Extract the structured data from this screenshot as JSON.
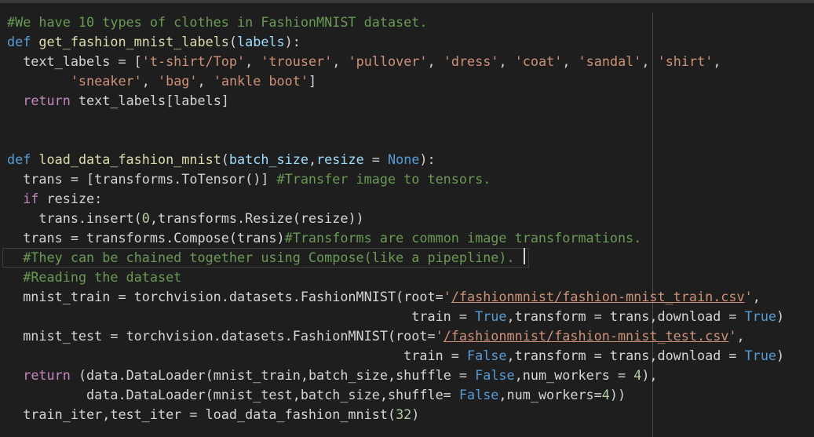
{
  "editor": {
    "lines": [
      [
        {
          "c": "cmt",
          "t": "#We have 10 types of clothes in FashionMNIST dataset."
        }
      ],
      [
        {
          "c": "kw",
          "t": "def "
        },
        {
          "c": "fn",
          "t": "get_fashion_mnist_labels"
        },
        {
          "c": "txt",
          "t": "("
        },
        {
          "c": "var",
          "t": "labels"
        },
        {
          "c": "txt",
          "t": "):"
        }
      ],
      [
        {
          "c": "txt",
          "t": "  text_labels = ["
        },
        {
          "c": "str",
          "t": "'t-shirt/Top'"
        },
        {
          "c": "txt",
          "t": ", "
        },
        {
          "c": "str",
          "t": "'trouser'"
        },
        {
          "c": "txt",
          "t": ", "
        },
        {
          "c": "str",
          "t": "'pullover'"
        },
        {
          "c": "txt",
          "t": ", "
        },
        {
          "c": "str",
          "t": "'dress'"
        },
        {
          "c": "txt",
          "t": ", "
        },
        {
          "c": "str",
          "t": "'coat'"
        },
        {
          "c": "txt",
          "t": ", "
        },
        {
          "c": "str",
          "t": "'sandal'"
        },
        {
          "c": "txt",
          "t": ", "
        },
        {
          "c": "str",
          "t": "'shirt'"
        },
        {
          "c": "txt",
          "t": ","
        }
      ],
      [
        {
          "c": "txt",
          "t": "        "
        },
        {
          "c": "str",
          "t": "'sneaker'"
        },
        {
          "c": "txt",
          "t": ", "
        },
        {
          "c": "str",
          "t": "'bag'"
        },
        {
          "c": "txt",
          "t": ", "
        },
        {
          "c": "str",
          "t": "'ankle boot'"
        },
        {
          "c": "txt",
          "t": "]"
        }
      ],
      [
        {
          "c": "txt",
          "t": "  "
        },
        {
          "c": "kw2",
          "t": "return"
        },
        {
          "c": "txt",
          "t": " text_labels[labels]"
        }
      ],
      [],
      [],
      [
        {
          "c": "kw",
          "t": "def "
        },
        {
          "c": "fn",
          "t": "load_data_fashion_mnist"
        },
        {
          "c": "txt",
          "t": "("
        },
        {
          "c": "var",
          "t": "batch_size"
        },
        {
          "c": "txt",
          "t": ","
        },
        {
          "c": "var",
          "t": "resize"
        },
        {
          "c": "txt",
          "t": " = "
        },
        {
          "c": "kw",
          "t": "None"
        },
        {
          "c": "txt",
          "t": "):"
        }
      ],
      [
        {
          "c": "txt",
          "t": "  trans = [transforms.ToTensor()] "
        },
        {
          "c": "cmt",
          "t": "#Transfer image to tensors."
        }
      ],
      [
        {
          "c": "txt",
          "t": "  "
        },
        {
          "c": "kw2",
          "t": "if"
        },
        {
          "c": "txt",
          "t": " resize:"
        }
      ],
      [
        {
          "c": "txt",
          "t": "    trans.insert("
        },
        {
          "c": "num",
          "t": "0"
        },
        {
          "c": "txt",
          "t": ",transforms.Resize(resize))"
        }
      ],
      [
        {
          "c": "txt",
          "t": "  trans = transforms.Compose(trans)"
        },
        {
          "c": "cmt",
          "t": "#Transforms are common image transformations."
        }
      ],
      [
        {
          "c": "txt",
          "t": "  "
        },
        {
          "c": "cmt",
          "t": "#They can be chained together using Compose(like a pipepline)."
        }
      ],
      [
        {
          "c": "txt",
          "t": "  "
        },
        {
          "c": "cmt",
          "t": "#Reading the dataset"
        }
      ],
      [
        {
          "c": "txt",
          "t": "  mnist_train = torchvision.datasets.FashionMNIST(root="
        },
        {
          "c": "str",
          "t": "'"
        },
        {
          "c": "str u",
          "t": "/fashionmnist/fashion-mnist_train.csv"
        },
        {
          "c": "str",
          "t": "'"
        },
        {
          "c": "txt",
          "t": ","
        }
      ],
      [
        {
          "c": "txt",
          "t": "                                                   train = "
        },
        {
          "c": "bool",
          "t": "True"
        },
        {
          "c": "txt",
          "t": ",transform = trans,download = "
        },
        {
          "c": "bool",
          "t": "True"
        },
        {
          "c": "txt",
          "t": ")"
        }
      ],
      [
        {
          "c": "txt",
          "t": "  mnist_test = torchvision.datasets.FashionMNIST(root="
        },
        {
          "c": "str",
          "t": "'"
        },
        {
          "c": "str u",
          "t": "/fashionmnist/fashion-mnist_test.csv"
        },
        {
          "c": "str",
          "t": "'"
        },
        {
          "c": "txt",
          "t": ","
        }
      ],
      [
        {
          "c": "txt",
          "t": "                                                  train = "
        },
        {
          "c": "bool",
          "t": "False"
        },
        {
          "c": "txt",
          "t": ",transform = trans,download = "
        },
        {
          "c": "bool",
          "t": "True"
        },
        {
          "c": "txt",
          "t": ")"
        }
      ],
      [
        {
          "c": "txt",
          "t": "  "
        },
        {
          "c": "kw2",
          "t": "return"
        },
        {
          "c": "txt",
          "t": " (data.DataLoader(mnist_train,batch_size,shuffle = "
        },
        {
          "c": "bool",
          "t": "False"
        },
        {
          "c": "txt",
          "t": ",num_workers = "
        },
        {
          "c": "num",
          "t": "4"
        },
        {
          "c": "txt",
          "t": "),"
        }
      ],
      [
        {
          "c": "txt",
          "t": "          data.DataLoader(mnist_test,batch_size,shuffle= "
        },
        {
          "c": "bool",
          "t": "False"
        },
        {
          "c": "txt",
          "t": ",num_workers="
        },
        {
          "c": "num",
          "t": "4"
        },
        {
          "c": "txt",
          "t": "))"
        }
      ],
      [
        {
          "c": "txt",
          "t": "  train_iter,test_iter = load_data_fashion_mnist("
        },
        {
          "c": "num",
          "t": "32"
        },
        {
          "c": "txt",
          "t": ")"
        }
      ]
    ],
    "current_line": 12
  }
}
